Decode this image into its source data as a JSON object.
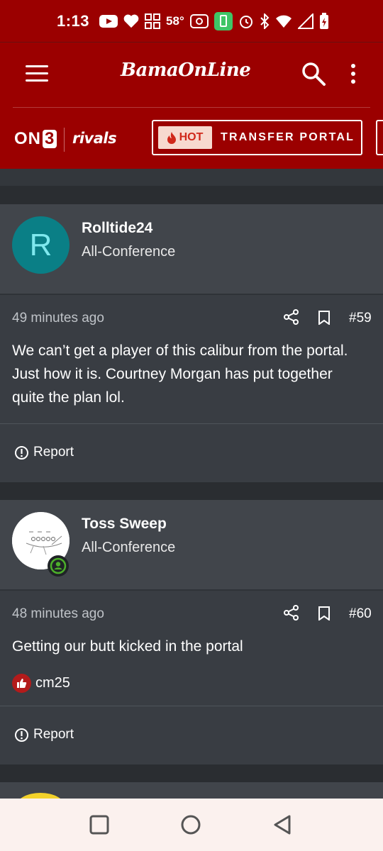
{
  "status_bar": {
    "time": "1:13",
    "temperature": "58°",
    "icons": [
      "youtube-icon",
      "heart-icon",
      "widgets-icon",
      "hotspot-icon",
      "battery-saver-icon",
      "alarm-icon",
      "bluetooth-icon",
      "wifi-icon",
      "signal-icon",
      "battery-icon"
    ]
  },
  "header": {
    "site_logo": "BamaOnLine",
    "on3_logo_on": "ON",
    "on3_logo_3": "3",
    "rivals_logo": "rivals",
    "hot_badge": "HOT",
    "portal_button": "TRANSFER PORTAL"
  },
  "posts": [
    {
      "avatar_letter": "R",
      "username": "Rolltide24",
      "user_title": "All-Conference",
      "time": "49 minutes ago",
      "post_number": "#59",
      "text": "We can’t get a player of this calibur from the portal. Just how it is. Courtney Morgan has put together quite the plan lol.",
      "report_label": "Report"
    },
    {
      "username": "Toss Sweep",
      "user_title": "All-Conference",
      "time": "48 minutes ago",
      "post_number": "#60",
      "text": "Getting our butt kicked in the portal",
      "reaction_user": "cm25",
      "report_label": "Report"
    }
  ],
  "colors": {
    "brand_red": "#9b0000",
    "card_head": "#41454b",
    "card_body": "#393d43",
    "avatar_teal": "#0a7f86",
    "online_green": "#4caf2a"
  }
}
